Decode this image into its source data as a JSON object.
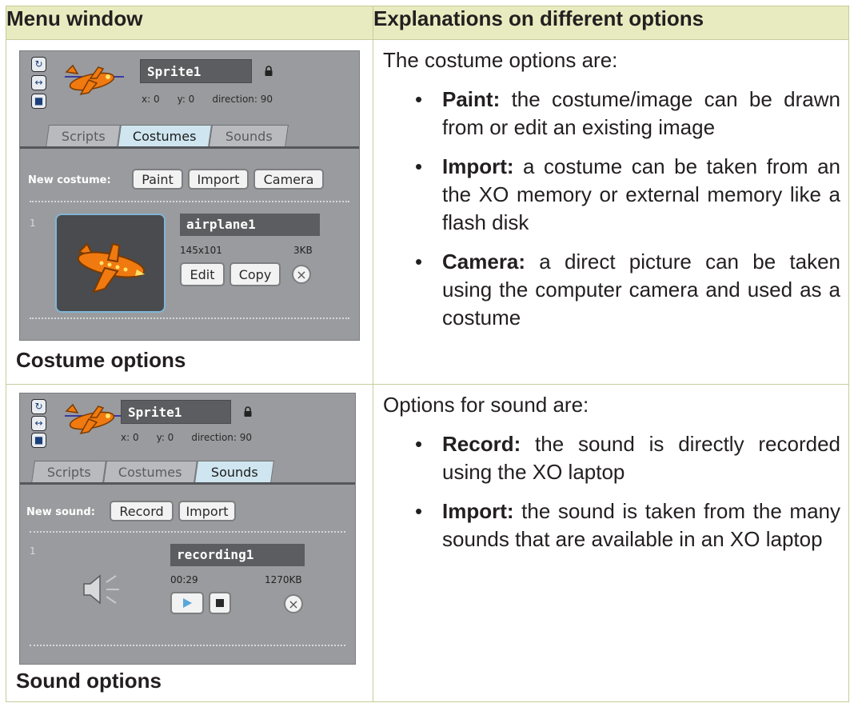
{
  "header": {
    "col1": "Menu window",
    "col2": "Explanations on different options"
  },
  "costume_row": {
    "caption": "Costume options",
    "panel": {
      "sprite_name": "Sprite1",
      "x": "x: 0",
      "y": "y: 0",
      "direction": "direction: 90",
      "tabs": [
        "Scripts",
        "Costumes",
        "Sounds"
      ],
      "active_tab": "Costumes",
      "new_label": "New costume:",
      "new_buttons": [
        "Paint",
        "Import",
        "Camera"
      ],
      "item_index": "1",
      "item_name": "airplane1",
      "item_size": "145x101",
      "item_kb": "3KB",
      "item_buttons": [
        "Edit",
        "Copy"
      ],
      "delete_glyph": "×"
    },
    "intro": "The costume options are:",
    "options": [
      {
        "term": "Paint:",
        "text": " the costume/image can be drawn from or edit an existing image"
      },
      {
        "term": "Import:",
        "text": " a costume can be taken from an the XO memory or external memory like a flash disk"
      },
      {
        "term": "Camera:",
        "text": " a direct picture can be taken using the computer camera and used as a costume"
      }
    ]
  },
  "sound_row": {
    "caption": "Sound options",
    "panel": {
      "sprite_name": "Sprite1",
      "x": "x: 0",
      "y": "y: 0",
      "direction": "direction: 90",
      "tabs": [
        "Scripts",
        "Costumes",
        "Sounds"
      ],
      "active_tab": "Sounds",
      "new_label": "New sound:",
      "new_buttons": [
        "Record",
        "Import"
      ],
      "item_index": "1",
      "item_name": "recording1",
      "item_time": "00:29",
      "item_kb": "1270KB",
      "delete_glyph": "×"
    },
    "intro": "Options for sound are:",
    "options": [
      {
        "term": "Record:",
        "text": " the sound is directly recorded using the XO laptop"
      },
      {
        "term": "Import:",
        "text": " the sound is taken from the many sounds that are available in an XO laptop"
      }
    ]
  },
  "colors": {
    "header_bg": "#e8ebc0",
    "border": "#c8cc9a",
    "panel_bg": "#9a9b9e",
    "active_tab": "#cfe6f0",
    "plane_orange": "#f07a10"
  },
  "icons": [
    "rotate-icon",
    "flip-icon",
    "no-rotate-icon",
    "airplane-sprite-icon",
    "lock-icon",
    "speaker-icon",
    "play-icon",
    "stop-icon",
    "delete-icon"
  ]
}
